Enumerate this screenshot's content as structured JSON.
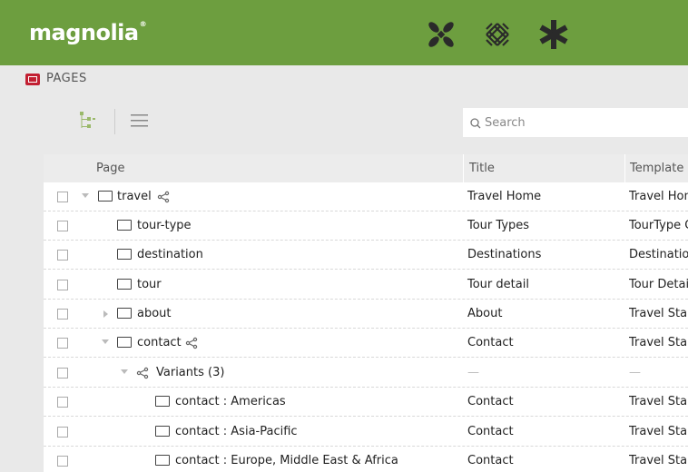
{
  "header": {
    "logo_text": "magnolia",
    "logo_mark": "®",
    "app_icons": [
      "apps-icon",
      "pulse-icon",
      "favorites-icon"
    ]
  },
  "app": {
    "name": "PAGES",
    "icon": "pages-app-icon",
    "accent": "#c21f32"
  },
  "brand_color": "#6d9e3f",
  "toolbar": {
    "views": [
      "tree-view-icon",
      "list-view-icon"
    ],
    "search_placeholder": "Search"
  },
  "grid": {
    "columns": [
      "Page",
      "Title",
      "Template"
    ],
    "rows": [
      {
        "name": "travel",
        "title": "Travel Home",
        "template": "Travel Home"
      },
      {
        "name": "tour-type",
        "title": "Tour Types",
        "template": "TourType Overview"
      },
      {
        "name": "destination",
        "title": "Destinations",
        "template": "Destination Overview"
      },
      {
        "name": "tour",
        "title": "Tour detail",
        "template": "Tour Detail"
      },
      {
        "name": "about",
        "title": "About",
        "template": "Travel Standard"
      },
      {
        "name": "contact",
        "title": "Contact",
        "template": "Travel Standard"
      },
      {
        "name": "Variants (3)",
        "title": "—",
        "template": "—"
      },
      {
        "name": "contact : Americas",
        "title": "Contact",
        "template": "Travel Standard"
      },
      {
        "name": "contact : Asia-Pacific",
        "title": "Contact",
        "template": "Travel Standard"
      },
      {
        "name": "contact : Europe, Middle East & Africa",
        "title": "Contact",
        "template": "Travel Standard"
      }
    ]
  }
}
